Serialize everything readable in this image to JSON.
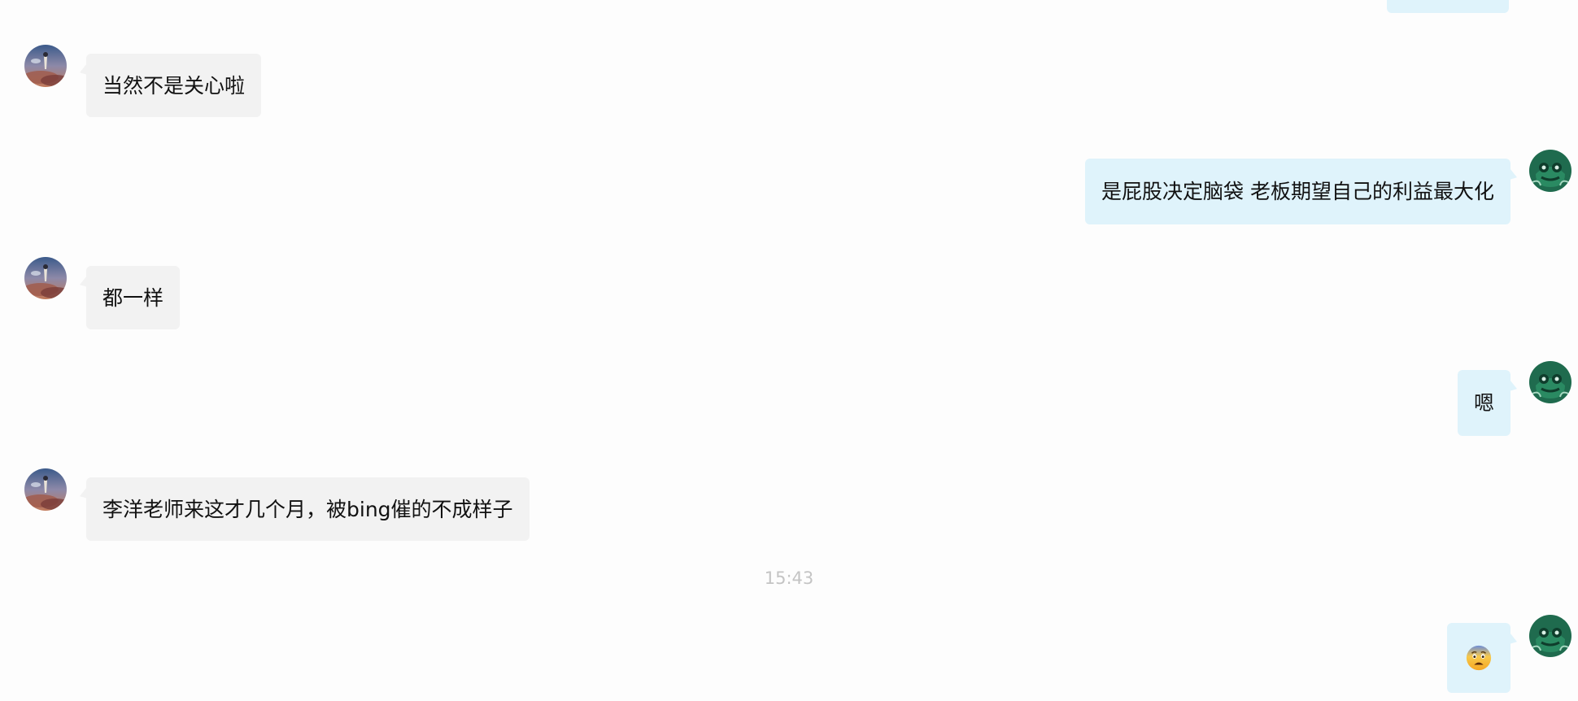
{
  "conversation": {
    "messages": [
      {
        "sender": "other",
        "text": "当然不是关心啦"
      },
      {
        "sender": "self",
        "text": "是屁股决定脑袋 老板期望自己的利益最大化"
      },
      {
        "sender": "other",
        "text": "都一样"
      },
      {
        "sender": "self",
        "text": "嗯"
      },
      {
        "sender": "other",
        "text": "李洋老师来这才几个月，被bing催的不成样子"
      },
      {
        "sender": "self",
        "emoji": "fearful-face-emoji"
      }
    ],
    "timestamp": "15:43"
  },
  "colors": {
    "incoming_bubble": "#f2f2f2",
    "outgoing_bubble": "#dff3fb",
    "timestamp_text": "#c4c4c4",
    "background": "#fdfdfd"
  },
  "icons": {
    "other_avatar": "anime-scenery-avatar",
    "self_avatar": "green-frog-avatar"
  }
}
